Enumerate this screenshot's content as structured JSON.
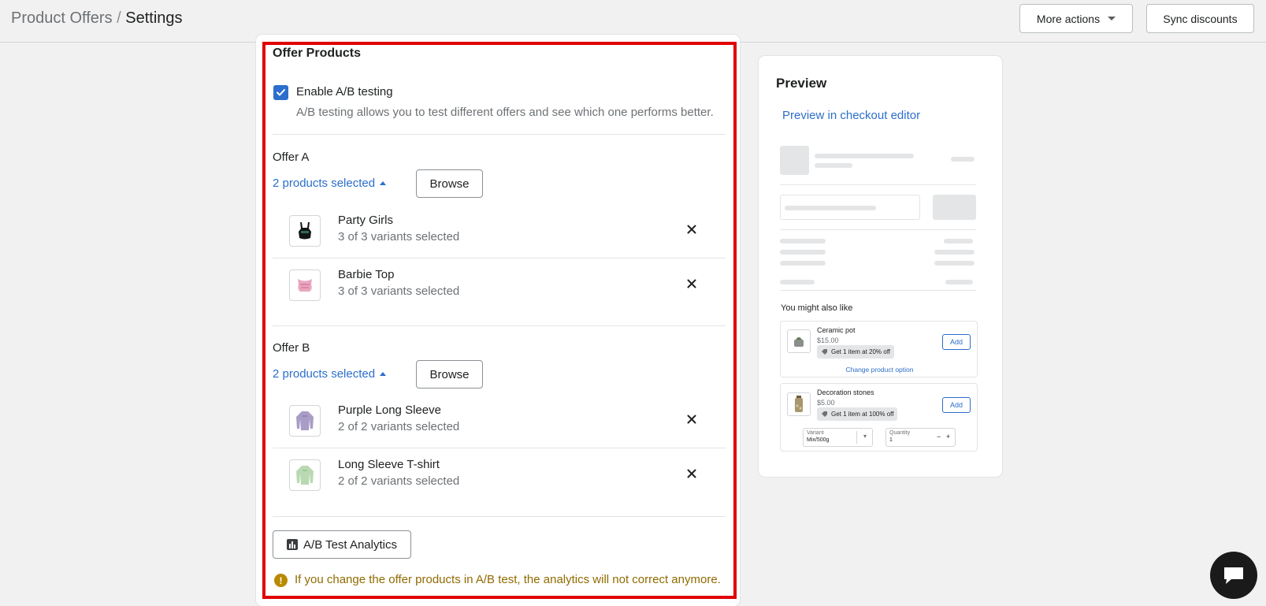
{
  "header": {
    "breadcrumb_parent": "Product Offers",
    "breadcrumb_sep": "/",
    "breadcrumb_current": "Settings",
    "more_actions_label": "More actions",
    "sync_label": "Sync discounts"
  },
  "main": {
    "title": "Offer Products",
    "ab_checkbox": {
      "label": "Enable A/B testing",
      "checked": true,
      "help": "A/B testing allows you to test different offers and see which one performs better."
    },
    "offers": [
      {
        "title": "Offer A",
        "selected_label": "2 products selected",
        "browse_label": "Browse",
        "products": [
          {
            "name": "Party Girls",
            "variants": "3 of 3 variants selected",
            "icon": "black-top-icon"
          },
          {
            "name": "Barbie Top",
            "variants": "3 of 3 variants selected",
            "icon": "pink-top-icon"
          }
        ]
      },
      {
        "title": "Offer B",
        "selected_label": "2 products selected",
        "browse_label": "Browse",
        "products": [
          {
            "name": "Purple Long Sleeve",
            "variants": "2 of 2 variants selected",
            "icon": "purple-sleeve-icon"
          },
          {
            "name": "Long Sleeve T-shirt",
            "variants": "2 of 2 variants selected",
            "icon": "green-sleeve-icon"
          }
        ]
      }
    ],
    "analytics_label": "A/B Test Analytics",
    "warning": "If you change the offer products in A/B test, the analytics will not correct anymore."
  },
  "preview": {
    "title": "Preview",
    "link": "Preview in checkout editor",
    "you_might_like": "You might also like",
    "items": [
      {
        "name": "Ceramic pot",
        "price": "$15.00",
        "badge": "Get 1 item at 20% off",
        "add": "Add",
        "change": "Change product option"
      },
      {
        "name": "Decoration stones",
        "price": "$5.00",
        "badge": "Get 1 item at 100% off",
        "add": "Add",
        "variant_label": "Variant",
        "variant_value": "Mix/500g",
        "qty_label": "Quantity",
        "qty_value": "1"
      }
    ]
  },
  "colors": {
    "accent": "#2c6ecb",
    "highlight": "#e00000",
    "warning": "#916a00"
  }
}
